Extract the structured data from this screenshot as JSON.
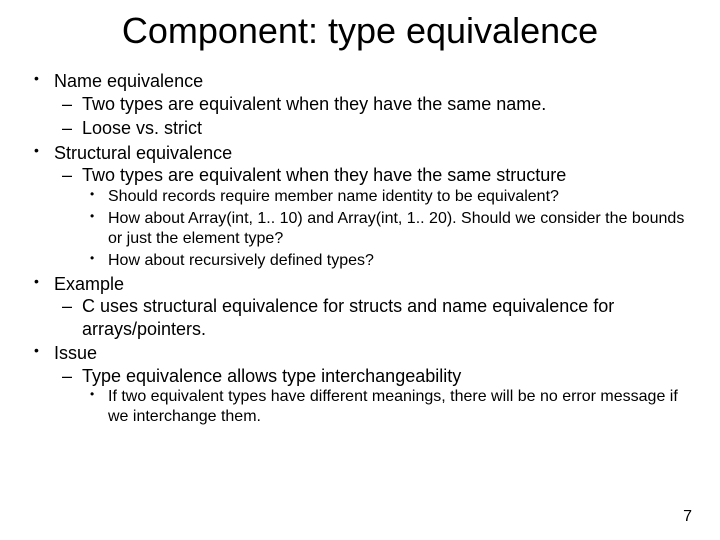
{
  "title": "Component: type equivalence",
  "items": [
    {
      "text": "Name equivalence",
      "sub": [
        {
          "text": "Two types are equivalent when they have the same name."
        },
        {
          "text": "Loose vs. strict"
        }
      ]
    },
    {
      "text": "Structural equivalence",
      "sub": [
        {
          "text": "Two types are equivalent when they have the same structure",
          "sub": [
            {
              "text": "Should records require member name identity to be equivalent?"
            },
            {
              "text": "How about Array(int, 1.. 10) and Array(int, 1.. 20). Should we consider the bounds or just the element type?"
            },
            {
              "text": "How about recursively defined types?"
            }
          ]
        }
      ]
    },
    {
      "text": "Example",
      "sub": [
        {
          "text": "C uses structural equivalence for structs and name equivalence for arrays/pointers."
        }
      ]
    },
    {
      "text": "Issue",
      "sub": [
        {
          "text": "Type equivalence allows type interchangeability",
          "sub": [
            {
              "text": "If two equivalent types have different meanings, there will be no error message if we interchange them."
            }
          ]
        }
      ]
    }
  ],
  "page_number": "7"
}
